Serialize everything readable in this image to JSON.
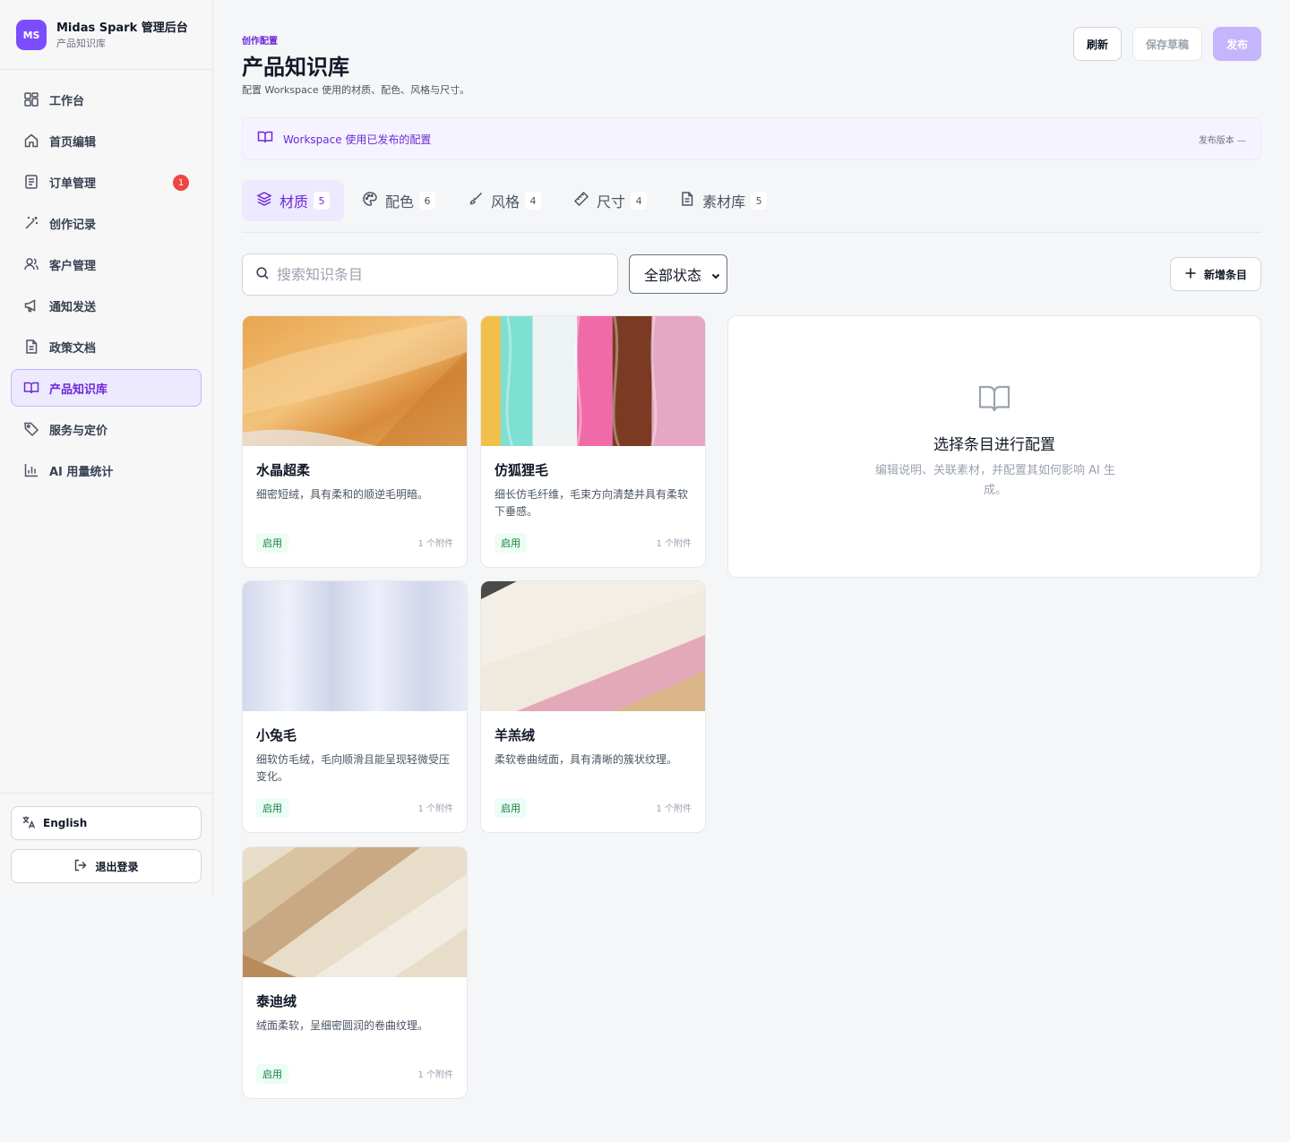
{
  "brand": {
    "logo": "MS",
    "title": "Midas Spark 管理后台",
    "subtitle": "产品知识库"
  },
  "nav": [
    {
      "label": "工作台",
      "icon": "dashboard-icon"
    },
    {
      "label": "首页编辑",
      "icon": "home-icon"
    },
    {
      "label": "订单管理",
      "icon": "order-icon",
      "badge": "1"
    },
    {
      "label": "创作记录",
      "icon": "magic-wand-icon"
    },
    {
      "label": "客户管理",
      "icon": "users-icon"
    },
    {
      "label": "通知发送",
      "icon": "megaphone-icon"
    },
    {
      "label": "政策文档",
      "icon": "document-icon"
    },
    {
      "label": "产品知识库",
      "icon": "book-icon",
      "active": true
    },
    {
      "label": "服务与定价",
      "icon": "tag-icon"
    },
    {
      "label": "AI 用量统计",
      "icon": "bar-chart-icon"
    }
  ],
  "sidebar_bottom": {
    "language": "English",
    "logout": "退出登录"
  },
  "header": {
    "eyebrow": "创作配置",
    "title": "产品知识库",
    "subtitle": "配置 Workspace 使用的材质、配色、风格与尺寸。",
    "refresh": "刷新",
    "save_draft": "保存草稿",
    "publish": "发布"
  },
  "notice": {
    "text": "Workspace 使用已发布的配置",
    "version": "发布版本 —"
  },
  "tabs": [
    {
      "label": "材质",
      "count": "5",
      "active": true
    },
    {
      "label": "配色",
      "count": "6"
    },
    {
      "label": "风格",
      "count": "4"
    },
    {
      "label": "尺寸",
      "count": "4"
    },
    {
      "label": "素材库",
      "count": "5"
    }
  ],
  "toolbar": {
    "search_placeholder": "搜索知识条目",
    "status_filter": "全部状态",
    "add_button": "新增条目"
  },
  "cards": [
    {
      "title": "水晶超柔",
      "desc": "细密短绒，具有柔和的顺逆毛明暗。",
      "status": "启用",
      "attachments": "1 个附件"
    },
    {
      "title": "仿狐狸毛",
      "desc": "细长仿毛纤维，毛束方向清楚并具有柔软下垂感。",
      "status": "启用",
      "attachments": "1 个附件"
    },
    {
      "title": "小兔毛",
      "desc": "细软仿毛绒，毛向顺滑且能呈现轻微受压变化。",
      "status": "启用",
      "attachments": "1 个附件"
    },
    {
      "title": "羊羔绒",
      "desc": "柔软卷曲绒面，具有清晰的簇状纹理。",
      "status": "启用",
      "attachments": "1 个附件"
    },
    {
      "title": "泰迪绒",
      "desc": "绒面柔软，呈细密圆润的卷曲纹理。",
      "status": "启用",
      "attachments": "1 个附件"
    }
  ],
  "empty_panel": {
    "title": "选择条目进行配置",
    "desc": "编辑说明、关联素材，并配置其如何影响 AI 生成。"
  },
  "colors": {
    "accent": "#7c4dff",
    "accent_text": "#6d28d9",
    "active_bg": "#ede9fe",
    "badge": "#ef4444",
    "status_green": "#15803d"
  }
}
